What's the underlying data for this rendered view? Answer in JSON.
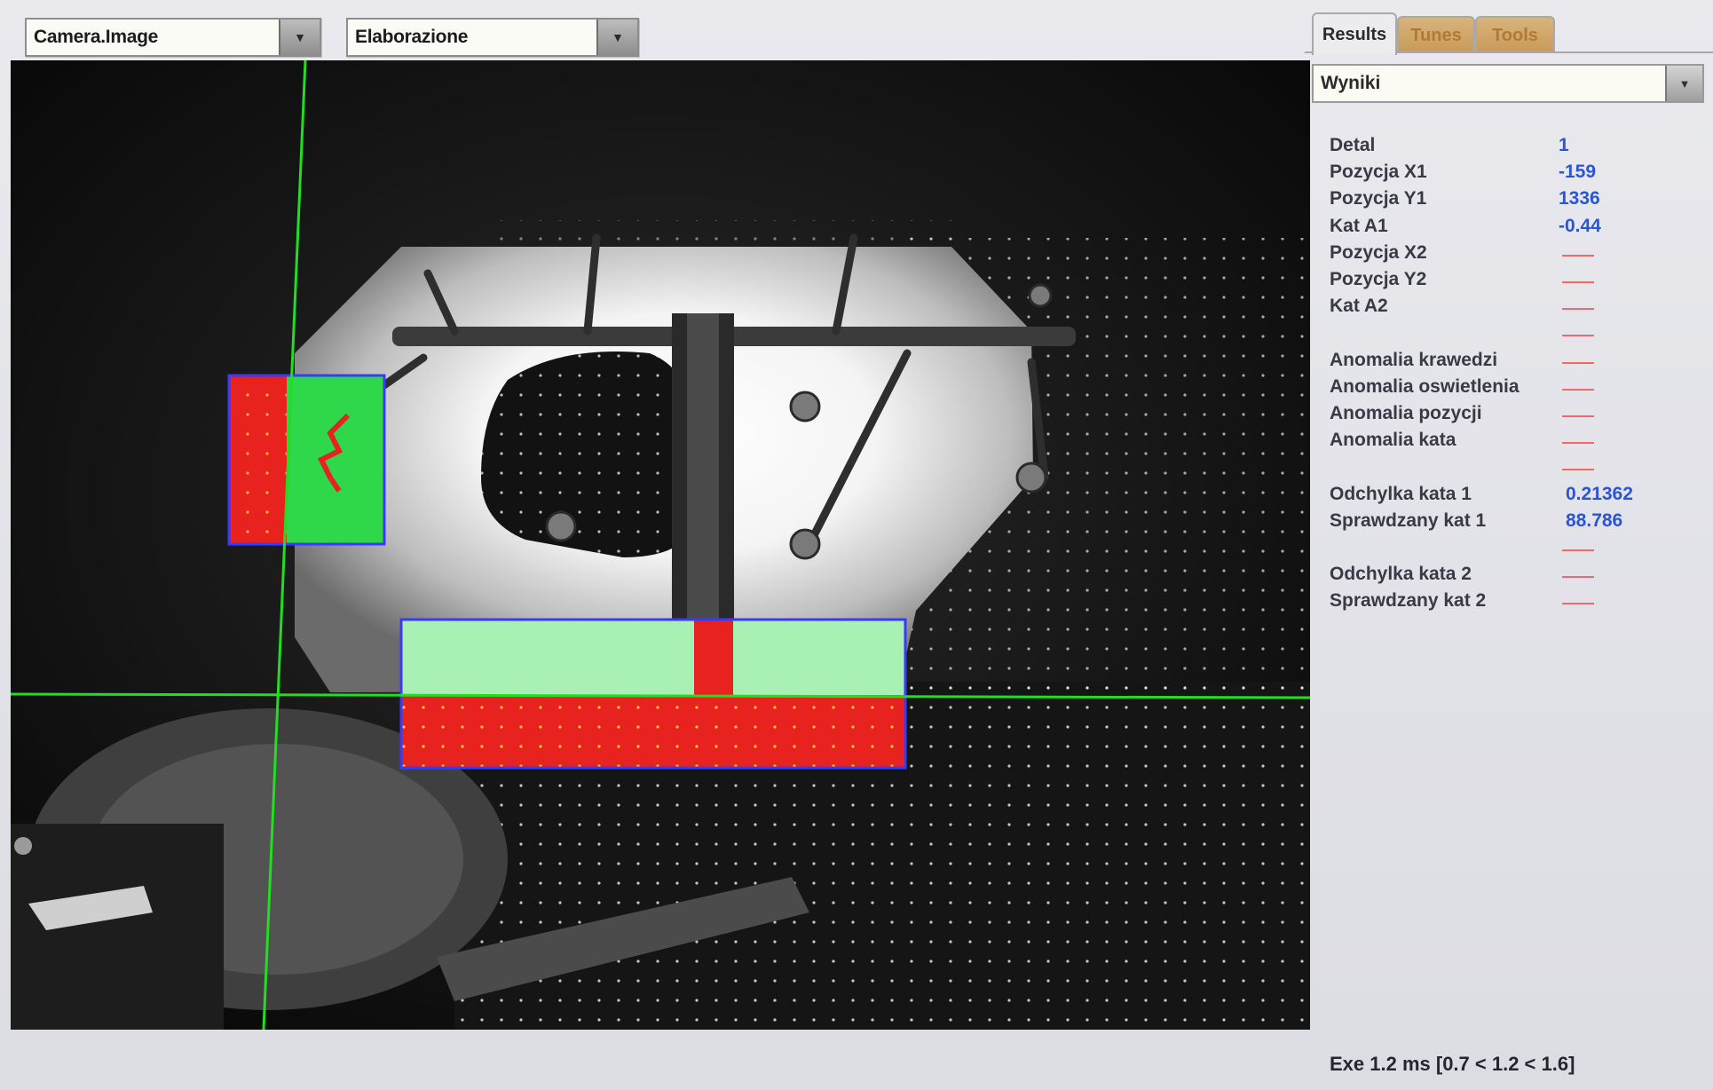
{
  "toolbar": {
    "source_select": "Camera.Image",
    "mode_select": "Elaborazione"
  },
  "tabs": [
    {
      "label": "Results",
      "active": true
    },
    {
      "label": "Tunes",
      "active": false
    },
    {
      "label": "Tools",
      "active": false
    }
  ],
  "results": {
    "view_select": "Wyniki",
    "rows": [
      {
        "label": "Detal",
        "value": "1"
      },
      {
        "label": "Pozycja X1",
        "value": "-159"
      },
      {
        "label": "Pozycja Y1",
        "value": "1336"
      },
      {
        "label": "Kat A1",
        "value": "-0.44"
      },
      {
        "label": "Pozycja X2",
        "value": ""
      },
      {
        "label": "Pozycja Y2",
        "value": ""
      },
      {
        "label": "Kat A2",
        "value": ""
      },
      {
        "label": "",
        "value": ""
      },
      {
        "label": "Anomalia krawedzi",
        "value": ""
      },
      {
        "label": "Anomalia oswietlenia",
        "value": ""
      },
      {
        "label": "Anomalia pozycji",
        "value": ""
      },
      {
        "label": "Anomalia kata",
        "value": ""
      },
      {
        "label": "",
        "value": ""
      },
      {
        "label": "Odchylka kata 1",
        "value": "0.21362"
      },
      {
        "label": "Sprawdzany kat 1",
        "value": "88.786"
      },
      {
        "label": "",
        "value": ""
      },
      {
        "label": "Odchylka kata 2",
        "value": ""
      },
      {
        "label": "Sprawdzany kat 2",
        "value": ""
      }
    ],
    "exec_time": "Exe 1.2 ms [0.7 < 1.2 < 1.6]"
  },
  "colors": {
    "value_blue": "#2a55d6",
    "empty_dash": "#f06a6a",
    "overlay_red": "#e8231f",
    "overlay_green": "#2fd84a",
    "overlay_lightgreen": "#a8f0b4",
    "roi_border": "#3a3aff",
    "crosshair": "#22dd22",
    "tab_inactive": "#c89a57"
  }
}
